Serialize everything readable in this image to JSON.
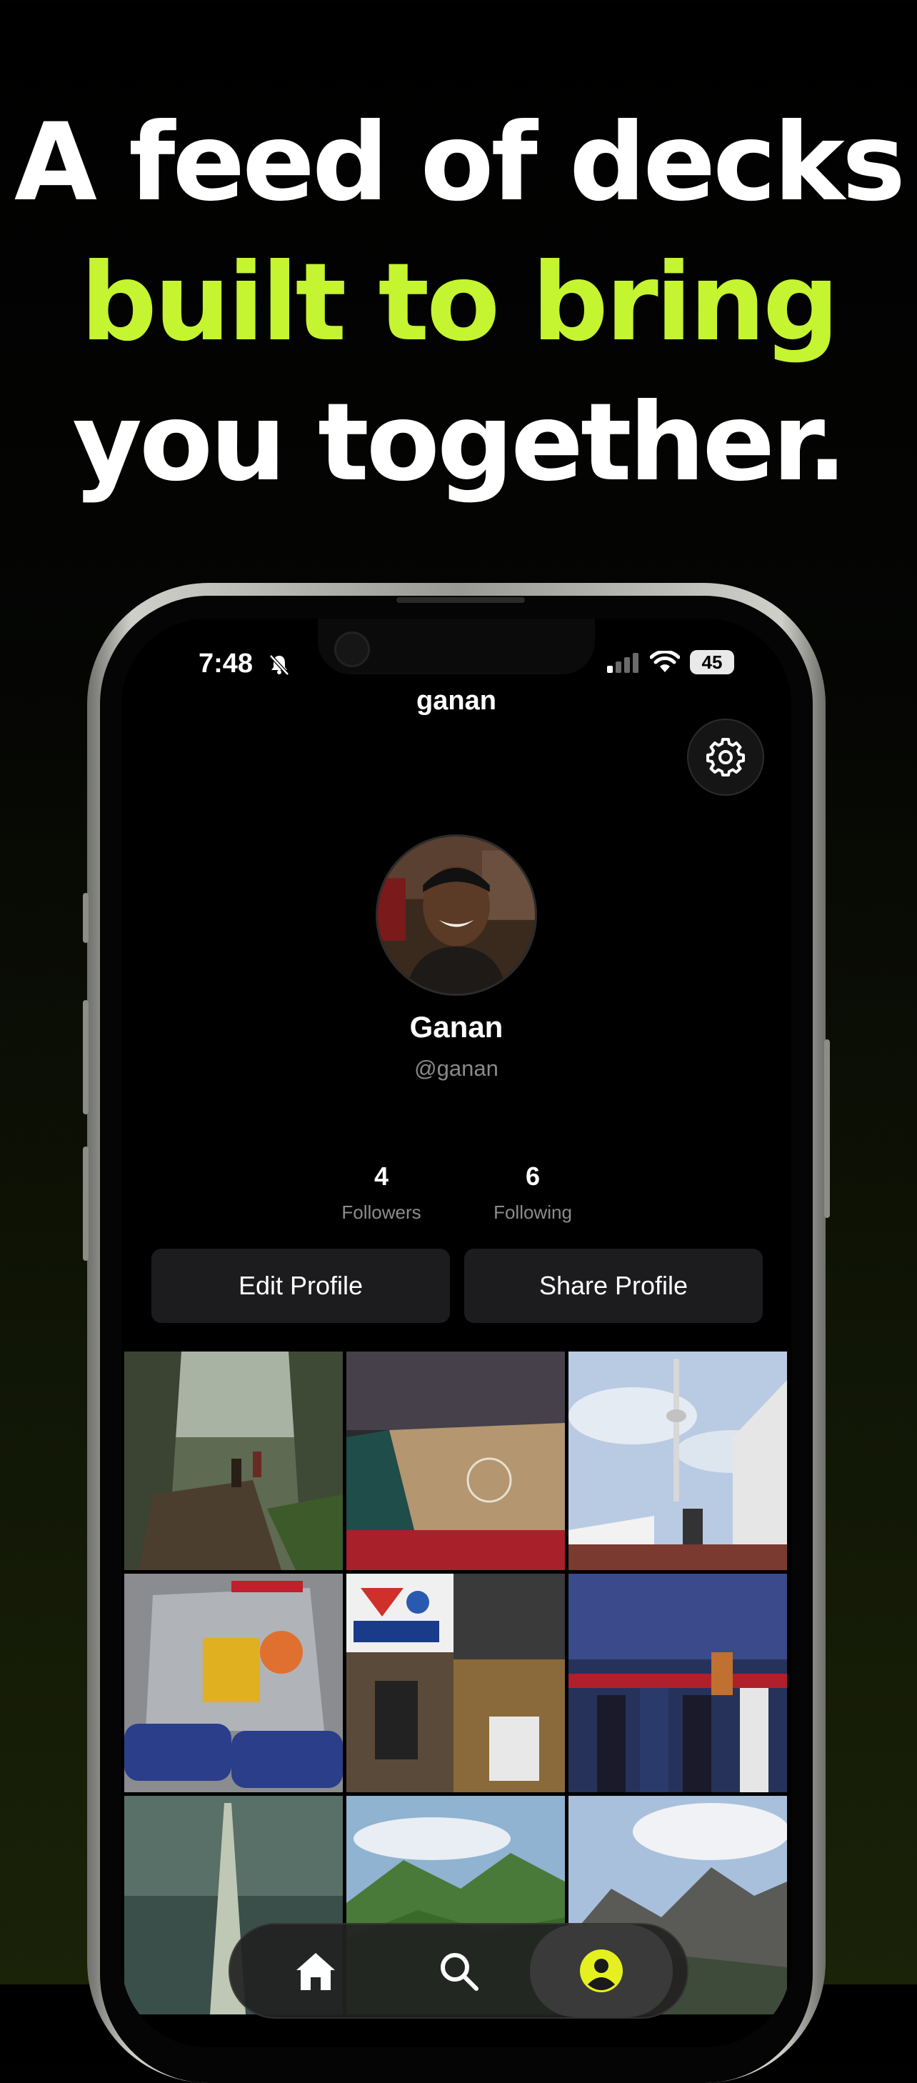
{
  "headline": {
    "line1": "A feed of decks",
    "line2": "built to bring",
    "line3": "you together."
  },
  "status_bar": {
    "time": "7:48",
    "battery": "45",
    "icons": [
      "bell-slash-icon",
      "signal-icon",
      "wifi-icon",
      "battery-icon"
    ]
  },
  "profile": {
    "title": "ganan",
    "display_name": "Ganan",
    "handle": "@ganan",
    "stats": [
      {
        "value": "4",
        "label": "Followers"
      },
      {
        "value": "6",
        "label": "Following"
      }
    ],
    "buttons": {
      "edit": "Edit Profile",
      "share": "Share Profile"
    }
  },
  "grid": {
    "tiles": [
      "canyon-hike-photo",
      "basketball-arena-photo",
      "cn-tower-photo",
      "robot-photo",
      "first-robotics-photo",
      "robotics-team-photo",
      "burj-khalifa-photo",
      "green-mountains-photo",
      "cliff-landscape-photo"
    ]
  },
  "tab_bar": {
    "items": [
      {
        "icon": "home-icon",
        "active": false
      },
      {
        "icon": "search-icon",
        "active": false
      },
      {
        "icon": "profile-icon",
        "active": true
      }
    ]
  },
  "colors": {
    "accent": "#c5f431",
    "background": "#000000",
    "button": "#1c1c1e"
  }
}
